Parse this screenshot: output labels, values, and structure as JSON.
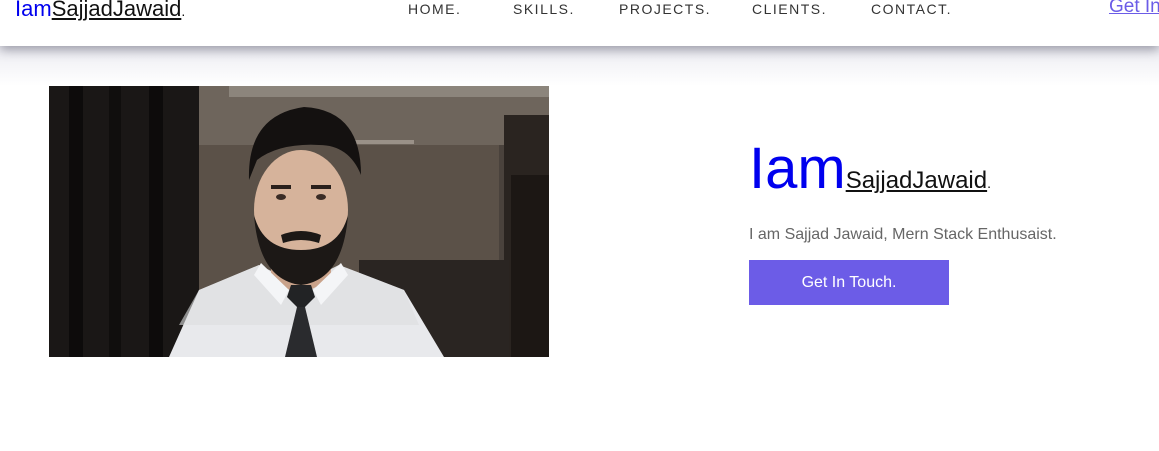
{
  "brand": {
    "prefix": "Iam",
    "name": "SajjadJawaid",
    "suffix": "."
  },
  "nav": {
    "items": [
      {
        "label": "HOME."
      },
      {
        "label": "SKILLS."
      },
      {
        "label": "PROJECTS."
      },
      {
        "label": "CLIENTS."
      },
      {
        "label": "CONTACT."
      }
    ],
    "cta_label": "Get In"
  },
  "hero": {
    "title_prefix": "Iam",
    "title_name": "SajjadJawaid",
    "title_suffix": ".",
    "tagline": "I am Sajjad Jawaid, Mern Stack Enthusaist.",
    "button_label": "Get In Touch."
  },
  "colors": {
    "accent": "#6c5ce7",
    "brand_blue": "#0000ee"
  }
}
